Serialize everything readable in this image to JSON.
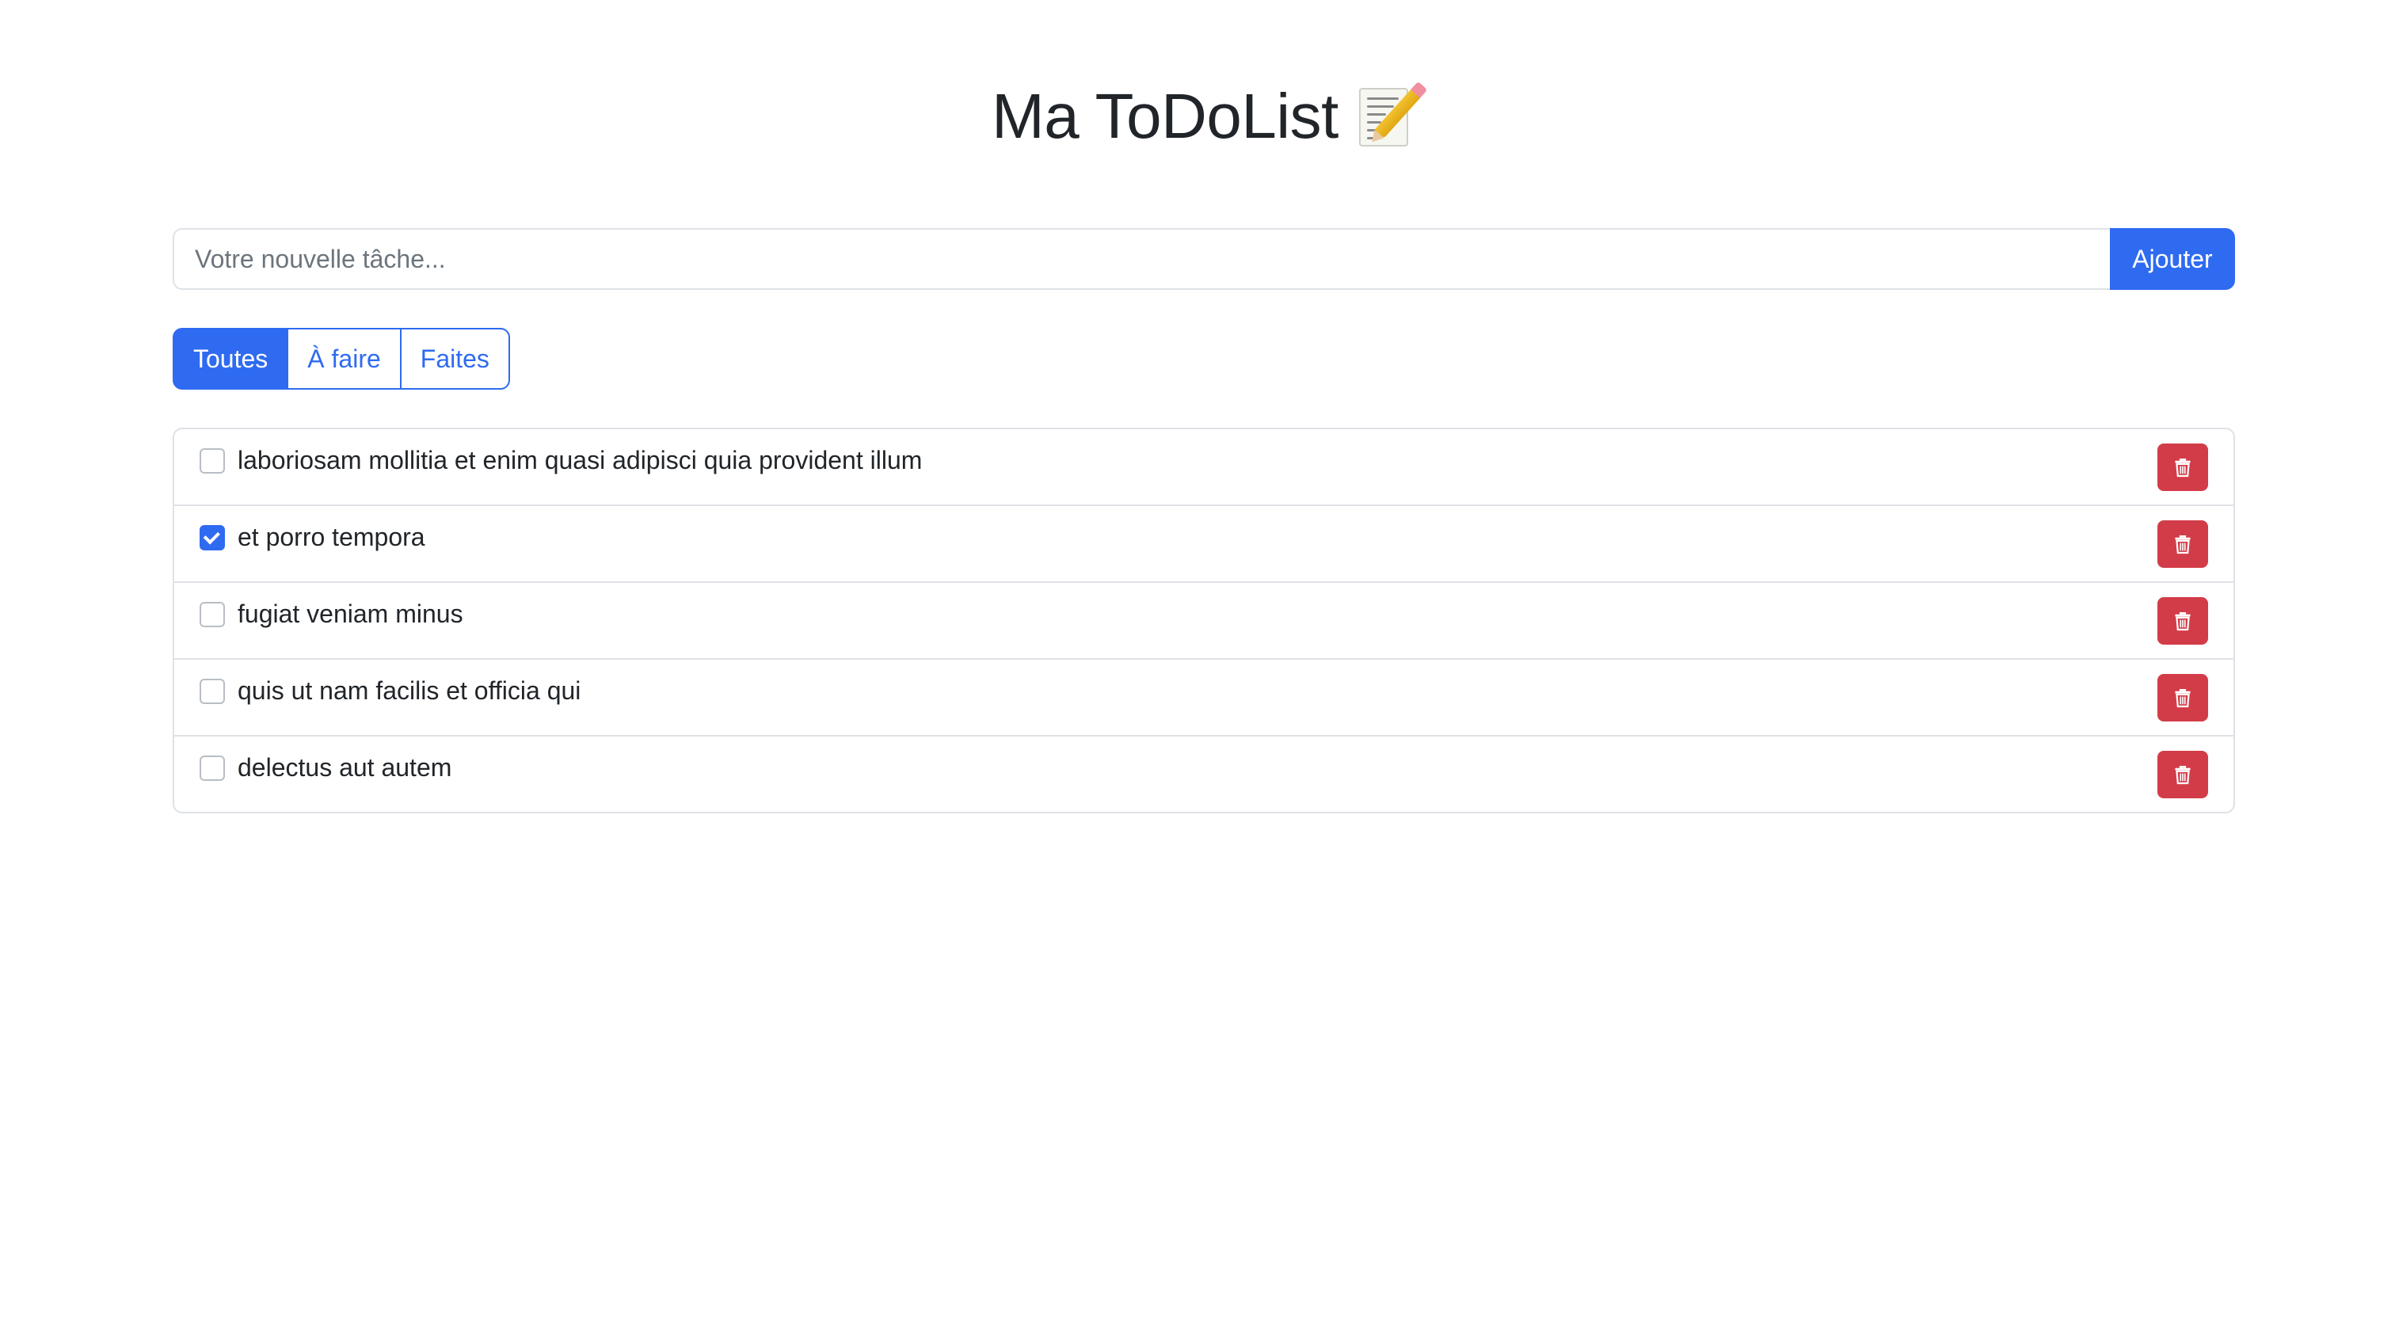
{
  "header": {
    "title": "Ma ToDoList",
    "title_icon": "memo-icon"
  },
  "new_task": {
    "placeholder": "Votre nouvelle tâche...",
    "value": "",
    "add_label": "Ajouter"
  },
  "filters": {
    "items": [
      {
        "label": "Toutes",
        "active": true
      },
      {
        "label": "À faire",
        "active": false
      },
      {
        "label": "Faites",
        "active": false
      }
    ]
  },
  "tasks": [
    {
      "label": "laboriosam mollitia et enim quasi adipisci quia provident illum",
      "done": false,
      "delete_icon": "trash-icon"
    },
    {
      "label": "et porro tempora",
      "done": true,
      "delete_icon": "trash-icon"
    },
    {
      "label": "fugiat veniam minus",
      "done": false,
      "delete_icon": "trash-icon"
    },
    {
      "label": "quis ut nam facilis et officia qui",
      "done": false,
      "delete_icon": "trash-icon"
    },
    {
      "label": "delectus aut autem",
      "done": false,
      "delete_icon": "trash-icon"
    }
  ],
  "colors": {
    "primary": "#2f6bf0",
    "danger": "#d23c48",
    "border": "#dee2e6",
    "text": "#212529"
  }
}
